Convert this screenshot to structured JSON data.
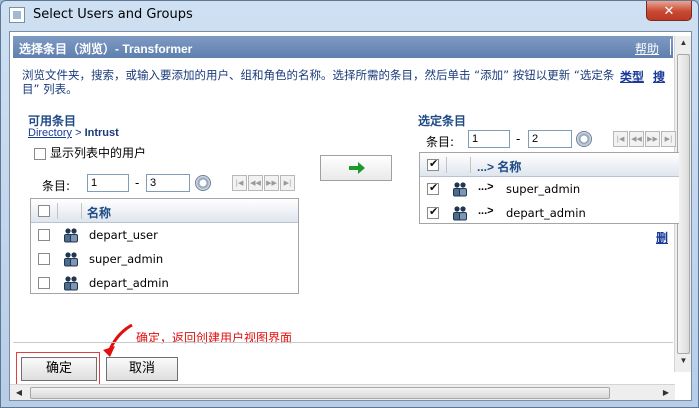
{
  "window": {
    "title": "Select Users and Groups",
    "close_label": "✕"
  },
  "header": {
    "title": "选择条目（浏览）- Transformer",
    "help": "帮助"
  },
  "instructions": "浏览文件夹，搜索，或输入要添加的用户、组和角色的名称。选择所需的条目，然后单击 “添加” 按钮以更新 “选定条目” 列表。",
  "links": {
    "type": "类型",
    "search": "搜"
  },
  "available": {
    "title": "可用条目",
    "breadcrumb": {
      "root": "Directory",
      "sep": ">",
      "current": "Intrust"
    },
    "show_users_label": "显示列表中的用户",
    "pager": {
      "label": "条目:",
      "from": "1",
      "dash": "-",
      "to": "3"
    },
    "column": "名称",
    "items": [
      {
        "name": "depart_user",
        "checked": false
      },
      {
        "name": "super_admin",
        "checked": false
      },
      {
        "name": "depart_admin",
        "checked": false
      }
    ]
  },
  "selected": {
    "title": "选定条目",
    "pager": {
      "label": "条目:",
      "from": "1",
      "dash": "-",
      "to": "2"
    },
    "column": "...> 名称",
    "items": [
      {
        "prefix": "...>",
        "name": "super_admin",
        "checked": true
      },
      {
        "prefix": "...>",
        "name": "depart_admin",
        "checked": true
      }
    ],
    "delete_link": "删"
  },
  "annotation": "确定，返回创建用户视图界面",
  "buttons": {
    "ok": "确定",
    "cancel": "取消"
  },
  "colors": {
    "header_bg": "#6f8cba",
    "link": "#1a3a9a",
    "section_title": "#1e4a86",
    "annotation": "#e01010",
    "add_arrow": "#1e9a2a"
  }
}
